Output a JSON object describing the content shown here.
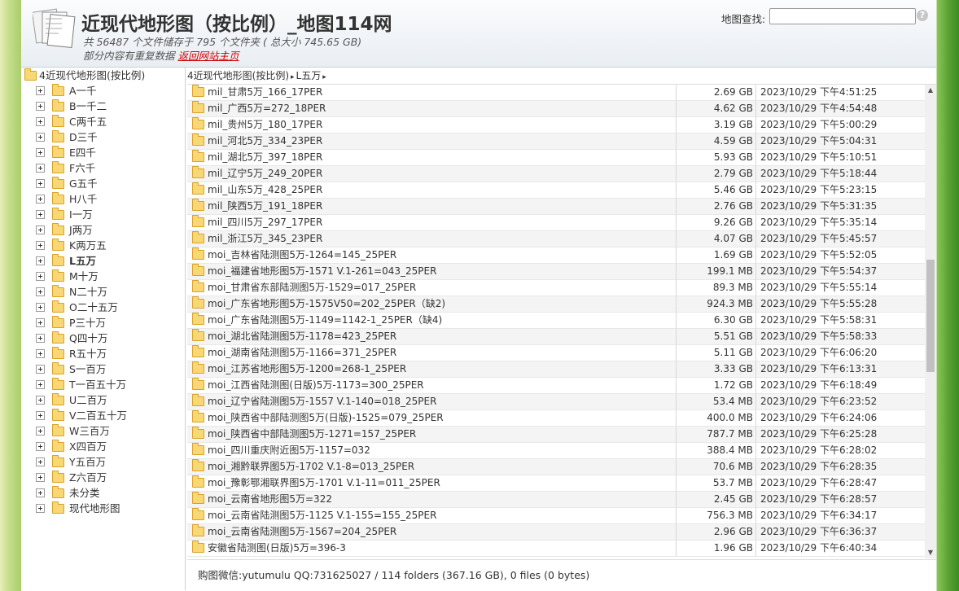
{
  "header": {
    "title": "近现代地形图（按比例）_地图114网",
    "stats": "共 56487 个文件储存于 795 个文件夹 ( 总大小 745.65 GB)",
    "note_prefix": "部分内容有重复数据 ",
    "note_link": "返回网站主页",
    "search_label": "地图查找:",
    "search_value": "",
    "help_glyph": "?"
  },
  "sidebar": {
    "root_label": "4近现代地形图(按比例)",
    "items": [
      {
        "label": "A一千"
      },
      {
        "label": "B一千二"
      },
      {
        "label": "C两千五"
      },
      {
        "label": "D三千"
      },
      {
        "label": "E四千"
      },
      {
        "label": "F六千"
      },
      {
        "label": "G五千"
      },
      {
        "label": "H八千"
      },
      {
        "label": "I一万"
      },
      {
        "label": "J两万"
      },
      {
        "label": "K两万五"
      },
      {
        "label": "L五万"
      },
      {
        "label": "M十万"
      },
      {
        "label": "N二十万"
      },
      {
        "label": "O二十五万"
      },
      {
        "label": "P三十万"
      },
      {
        "label": "Q四十万"
      },
      {
        "label": "R五十万"
      },
      {
        "label": "S一百万"
      },
      {
        "label": "T一百五十万"
      },
      {
        "label": "U二百万"
      },
      {
        "label": "V二百五十万"
      },
      {
        "label": "W三百万"
      },
      {
        "label": "X四百万"
      },
      {
        "label": "Y五百万"
      },
      {
        "label": "Z六百万"
      },
      {
        "label": "未分类"
      },
      {
        "label": "现代地形图"
      }
    ],
    "selected_index": 11
  },
  "breadcrumb": {
    "segments": [
      "4近现代地形图(按比例)",
      "L五万"
    ],
    "separator": "▸"
  },
  "rows": [
    {
      "name": "mil_甘肃5万_166_17PER",
      "size": "2.69 GB",
      "date": "2023/10/29 下午4:51:25"
    },
    {
      "name": "mil_广西5万=272_18PER",
      "size": "4.62 GB",
      "date": "2023/10/29 下午4:54:48"
    },
    {
      "name": "mil_贵州5万_180_17PER",
      "size": "3.19 GB",
      "date": "2023/10/29 下午5:00:29"
    },
    {
      "name": "mil_河北5万_334_23PER",
      "size": "4.59 GB",
      "date": "2023/10/29 下午5:04:31"
    },
    {
      "name": "mil_湖北5万_397_18PER",
      "size": "5.93 GB",
      "date": "2023/10/29 下午5:10:51"
    },
    {
      "name": "mil_辽宁5万_249_20PER",
      "size": "2.79 GB",
      "date": "2023/10/29 下午5:18:44"
    },
    {
      "name": "mil_山东5万_428_25PER",
      "size": "5.46 GB",
      "date": "2023/10/29 下午5:23:15"
    },
    {
      "name": "mil_陕西5万_191_18PER",
      "size": "2.76 GB",
      "date": "2023/10/29 下午5:31:35"
    },
    {
      "name": "mil_四川5万_297_17PER",
      "size": "9.26 GB",
      "date": "2023/10/29 下午5:35:14"
    },
    {
      "name": "mil_浙江5万_345_23PER",
      "size": "4.07 GB",
      "date": "2023/10/29 下午5:45:57"
    },
    {
      "name": "moi_吉林省陆测图5万-1264=145_25PER",
      "size": "1.69 GB",
      "date": "2023/10/29 下午5:52:05"
    },
    {
      "name": "moi_福建省地形图5万-1571 V.1-261=043_25PER",
      "size": "199.1 MB",
      "date": "2023/10/29 下午5:54:37"
    },
    {
      "name": "moi_甘肃省东部陆测图5万-1529=017_25PER",
      "size": "89.3 MB",
      "date": "2023/10/29 下午5:55:14"
    },
    {
      "name": "moi_广东省地形图5万-1575V50=202_25PER（缺2)",
      "size": "924.3 MB",
      "date": "2023/10/29 下午5:55:28"
    },
    {
      "name": "moi_广东省陆测图5万-1149=1142-1_25PER（缺4)",
      "size": "6.30 GB",
      "date": "2023/10/29 下午5:58:31"
    },
    {
      "name": "moi_湖北省陆测图5万-1178=423_25PER",
      "size": "5.51 GB",
      "date": "2023/10/29 下午5:58:33"
    },
    {
      "name": "moi_湖南省陆测图5万-1166=371_25PER",
      "size": "5.11 GB",
      "date": "2023/10/29 下午6:06:20"
    },
    {
      "name": "moi_江苏省地形图5万-1200=268-1_25PER",
      "size": "3.33 GB",
      "date": "2023/10/29 下午6:13:31"
    },
    {
      "name": "moi_江西省陆测图(日版)5万-1173=300_25PER",
      "size": "1.72 GB",
      "date": "2023/10/29 下午6:18:49"
    },
    {
      "name": "moi_辽宁省陆测图5万-1557 V.1-140=018_25PER",
      "size": "53.4 MB",
      "date": "2023/10/29 下午6:23:52"
    },
    {
      "name": "moi_陕西省中部陆测图5万(日版)-1525=079_25PER",
      "size": "400.0 MB",
      "date": "2023/10/29 下午6:24:06"
    },
    {
      "name": "moi_陕西省中部陆测图5万-1271=157_25PER",
      "size": "787.7 MB",
      "date": "2023/10/29 下午6:25:28"
    },
    {
      "name": "moi_四川重庆附近图5万-1157=032",
      "size": "388.4 MB",
      "date": "2023/10/29 下午6:28:02"
    },
    {
      "name": "moi_湘黔联界图5万-1702 V.1-8=013_25PER",
      "size": "70.6 MB",
      "date": "2023/10/29 下午6:28:35"
    },
    {
      "name": "moi_豫彰鄂湘联界图5万-1701 V.1-11=011_25PER",
      "size": "53.7 MB",
      "date": "2023/10/29 下午6:28:47"
    },
    {
      "name": "moi_云南省地形图5万=322",
      "size": "2.45 GB",
      "date": "2023/10/29 下午6:28:57"
    },
    {
      "name": "moi_云南省陆测图5万-1125 V.1-155=155_25PER",
      "size": "756.3 MB",
      "date": "2023/10/29 下午6:34:17"
    },
    {
      "name": "moi_云南省陆测图5万-1567=204_25PER",
      "size": "2.96 GB",
      "date": "2023/10/29 下午6:36:37"
    },
    {
      "name": "安徽省陆测图(日版)5万=396-3",
      "size": "1.96 GB",
      "date": "2023/10/29 下午6:40:34"
    }
  ],
  "scrollbar": {
    "up_glyph": "▲",
    "down_glyph": "▼"
  },
  "footer": {
    "summary": "购图微信:yutumulu QQ:731625027 / 114 folders (367.16 GB), 0 files (0 bytes)"
  },
  "colors": {
    "link": "#cc0000",
    "folder_fill": "#f8d775",
    "folder_border": "#d9a22a"
  }
}
